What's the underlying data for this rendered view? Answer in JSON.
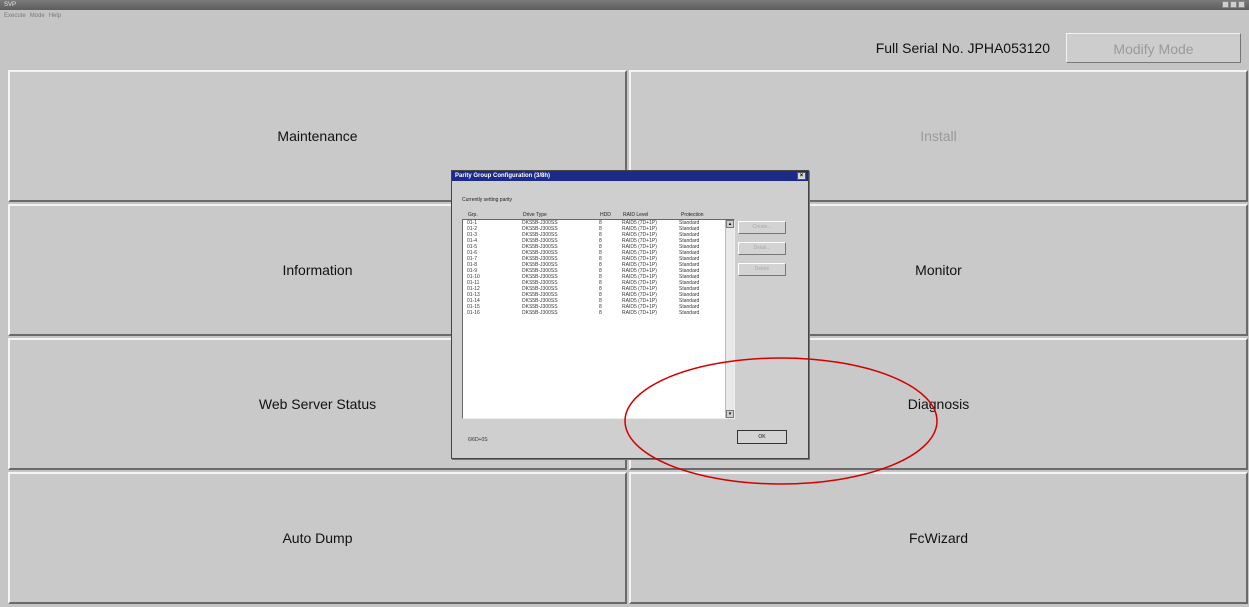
{
  "window": {
    "title": "SVP",
    "menu": [
      "Execute",
      "Mode",
      "Help"
    ]
  },
  "header": {
    "serial": "Full Serial No. JPHA053120",
    "modify_mode": "Modify Mode"
  },
  "buttons": {
    "maintenance": "Maintenance",
    "install": "Install",
    "information": "Information",
    "monitor": "Monitor",
    "web_server_status": "Web Server Status",
    "diagnosis": "Diagnosis",
    "auto_dump": "Auto Dump",
    "fcwizard": "FcWizard"
  },
  "dialog": {
    "title": "Parity Group Configuration (3/8h)",
    "subtitle": "Currently setting parity",
    "columns": [
      "Grp.",
      "Drive Type",
      "HDD",
      "RAID Level",
      "Protection"
    ],
    "rows": [
      [
        "01-1",
        "DKS5B-J300SS",
        "8",
        "RAID5 (7D+1P)",
        "Standard"
      ],
      [
        "01-2",
        "DKS5B-J300SS",
        "8",
        "RAID5 (7D+1P)",
        "Standard"
      ],
      [
        "01-3",
        "DKS5B-J300SS",
        "8",
        "RAID5 (7D+1P)",
        "Standard"
      ],
      [
        "01-4",
        "DKS5B-J300SS",
        "8",
        "RAID5 (7D+1P)",
        "Standard"
      ],
      [
        "01-5",
        "DKS5B-J300SS",
        "8",
        "RAID5 (7D+1P)",
        "Standard"
      ],
      [
        "01-6",
        "DKS5B-J300SS",
        "8",
        "RAID5 (7D+1P)",
        "Standard"
      ],
      [
        "01-7",
        "DKS5B-J300SS",
        "8",
        "RAID5 (7D+1P)",
        "Standard"
      ],
      [
        "01-8",
        "DKS5B-J300SS",
        "8",
        "RAID5 (7D+1P)",
        "Standard"
      ],
      [
        "01-9",
        "DKS5B-J300SS",
        "8",
        "RAID5 (7D+1P)",
        "Standard"
      ],
      [
        "01-10",
        "DKS5B-J300SS",
        "8",
        "RAID5 (7D+1P)",
        "Standard"
      ],
      [
        "01-11",
        "DKS5B-J300SS",
        "8",
        "RAID5 (7D+1P)",
        "Standard"
      ],
      [
        "01-12",
        "DKS5B-J300SS",
        "8",
        "RAID5 (7D+1P)",
        "Standard"
      ],
      [
        "01-13",
        "DKS5B-J300SS",
        "8",
        "RAID5 (7D+1P)",
        "Standard"
      ],
      [
        "01-14",
        "DKS5B-J300SS",
        "8",
        "RAID5 (7D+1P)",
        "Standard"
      ],
      [
        "01-15",
        "DKS5B-J300SS",
        "8",
        "RAID5 (7D+1P)",
        "Standard"
      ],
      [
        "01-16",
        "DKS5B-J300SS",
        "8",
        "RAID5 (7D+1P)",
        "Standard"
      ]
    ],
    "side_buttons": [
      "Create...",
      "Detail...",
      "Delete"
    ],
    "status": "6/6D+0S",
    "ok_label": "OK"
  },
  "colors": {
    "annotation": "#d40000",
    "dialog_title": "#1c2a8a"
  }
}
